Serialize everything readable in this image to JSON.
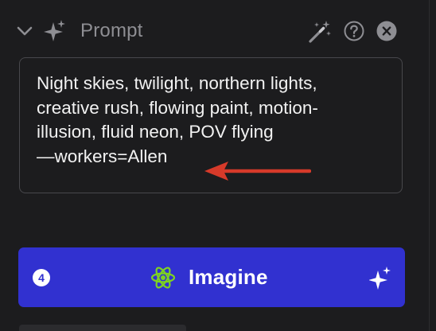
{
  "header": {
    "title": "Prompt",
    "icons": {
      "collapse": "chevron-down-icon",
      "section": "sparkles-icon",
      "enhance": "magic-wand-icon",
      "help": "help-icon",
      "close": "close-icon"
    }
  },
  "prompt": {
    "text": "Night skies, twilight, northern lights, creative rush, flowing paint, motion-illusion, fluid neon, POV flying —workers=Allen",
    "lines": [
      "Night skies, twilight, northern lights,",
      "creative rush, flowing paint, motion-",
      "illusion, fluid neon, POV flying",
      "—workers=Allen"
    ],
    "annotation": {
      "icon": "red-arrow-icon",
      "color": "#d63a2a"
    }
  },
  "imagine_button": {
    "label": "Imagine",
    "count": "4",
    "icon": "atom-icon",
    "trailing_icon": "sparkles-icon",
    "color": "#3131d0",
    "icon_color": "#7ed321"
  }
}
